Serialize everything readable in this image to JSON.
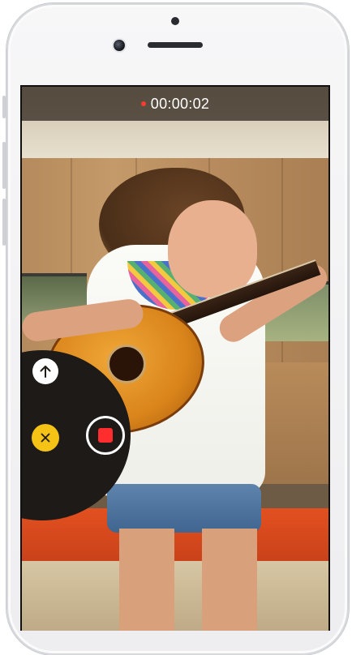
{
  "status_bar": {
    "recording_time": "00:00:02",
    "recording_indicator_color": "#ff3b30"
  },
  "controls": {
    "upload_icon": "arrow-up-icon",
    "cancel_icon": "close-icon",
    "stop_icon": "stop-square-icon",
    "cancel_color": "#f5c315",
    "stop_color": "#ff2d2d"
  }
}
